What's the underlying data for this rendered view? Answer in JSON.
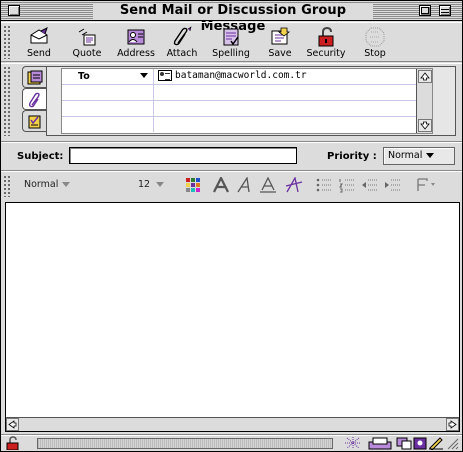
{
  "window": {
    "title": "Send Mail or Discussion Group Message"
  },
  "toolbar": {
    "buttons": [
      {
        "label": "Send",
        "icon": "send-icon"
      },
      {
        "label": "Quote",
        "icon": "quote-icon"
      },
      {
        "label": "Address",
        "icon": "address-book-icon"
      },
      {
        "label": "Attach",
        "icon": "paperclip-icon"
      },
      {
        "label": "Spelling",
        "icon": "spelling-icon"
      },
      {
        "label": "Save",
        "icon": "save-icon"
      },
      {
        "label": "Security",
        "icon": "lock-icon"
      },
      {
        "label": "Stop",
        "icon": "stop-icon"
      }
    ]
  },
  "address": {
    "tabs": [
      {
        "icon": "address-card-icon",
        "active": false
      },
      {
        "icon": "paperclip-icon",
        "active": true
      },
      {
        "icon": "options-icon",
        "active": false
      }
    ],
    "recipients": [
      {
        "type": "To",
        "address": "bataman@macworld.com.tr"
      }
    ]
  },
  "subject": {
    "label": "Subject:",
    "value": ""
  },
  "priority": {
    "label": "Priority :",
    "value": "Normal"
  },
  "format": {
    "paragraph_style": "Normal",
    "font_size": "12",
    "icons": [
      "color-icon",
      "bold-a-icon",
      "italic-a-icon",
      "underline-a-icon",
      "strike-a-icon",
      "bulleted-list-icon",
      "numbered-list-icon",
      "outdent-icon",
      "indent-icon",
      "insert-icon"
    ]
  },
  "colors": {
    "chrome": "#dcdcdc",
    "accent_purple": "#6b2fa0",
    "lock_red": "#cc1f1f"
  }
}
